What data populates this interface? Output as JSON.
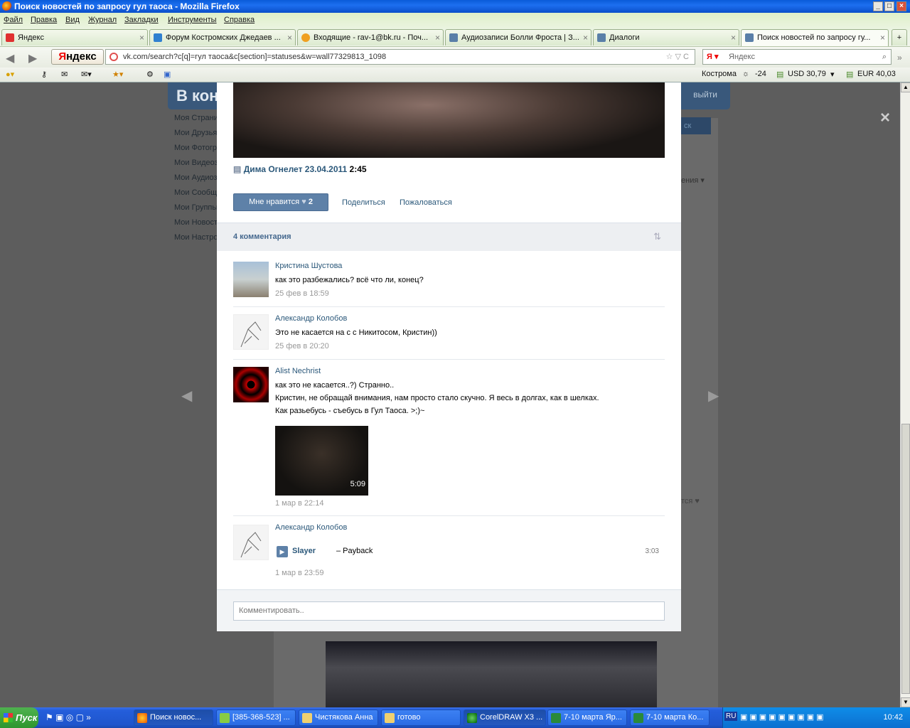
{
  "window": {
    "title": "Поиск новостей по запросу гул таоса - Mozilla Firefox"
  },
  "menu": [
    "Файл",
    "Правка",
    "Вид",
    "Журнал",
    "Закладки",
    "Инструменты",
    "Справка"
  ],
  "tabs": [
    {
      "label": "Яндекс",
      "color": "#e03030"
    },
    {
      "label": "Форум Костромских Джедаев ...",
      "color": "#3080d0"
    },
    {
      "label": "Входящие - rav-1@bk.ru - Поч...",
      "color": "#f0a020"
    },
    {
      "label": "Аудиозаписи Болли Фроста | З...",
      "color": "#5a7fa8"
    },
    {
      "label": "Диалоги",
      "color": "#5a7fa8"
    },
    {
      "label": "Поиск новостей по запросу гу...",
      "color": "#5a7fa8"
    }
  ],
  "nav": {
    "yandex_label_first": "Я",
    "yandex_label_rest": "ндекс",
    "url": "vk.com/search?c[q]=гул таоса&c[section]=statuses&w=wall77329813_1098",
    "search_placeholder": "Яндекс"
  },
  "toolbar2": {
    "city": "Кострома",
    "temp": "-24",
    "usd": "USD 30,79",
    "eur": "EUR 40,03"
  },
  "vk": {
    "logo": "В кон",
    "exit": "выйти",
    "sidebar": [
      "Моя Страни",
      "Мои Друзья",
      "Мои Фотогр",
      "Мои Видеоз",
      "Мои Аудиоз",
      "Мои Сообще",
      "Мои Группы",
      "Мои Новост",
      "Мои Настро"
    ],
    "bg_search": "ск",
    "bg_sort": "ения ▾",
    "bg_like": "тся ♥"
  },
  "post": {
    "video_author": "Дима Огнелет",
    "video_date": "23.04.2011",
    "video_duration": "2:45",
    "like_label": "Мне нравится",
    "like_count": "2",
    "share": "Поделиться",
    "report": "Пожаловаться",
    "comments_title": "4 комментария"
  },
  "comments": [
    {
      "author": "Кристина Шустова",
      "text": "как это разбежались? всё что ли, конец?",
      "date": "25 фев в 18:59"
    },
    {
      "author": "Александр Колобов",
      "text": "Это не касается на с с Никитосом, Кристин))",
      "date": "25 фев в 20:20"
    },
    {
      "author": "Alist Nechrist",
      "lines": [
        "как это не касается..?) Странно..",
        "Кристин, не обращай внимания, нам просто стало скучно. Я весь в долгах, как в шелках.",
        "Как разьебусь - съебусь в Гул Таоса. >;)~"
      ],
      "video_duration": "5:09",
      "date": "1 мар в 22:14"
    },
    {
      "author": "Александр Колобов",
      "audio_artist": "Slayer",
      "audio_title": "– Payback",
      "audio_duration": "3:03",
      "date": "1 мар в 23:59"
    }
  ],
  "comment_placeholder": "Комментировать..",
  "taskbar": {
    "start": "Пуск",
    "tasks": [
      "Поиск новос...",
      "[385-368-523] ...",
      "Чистякова Анна",
      "готово",
      "CorelDRAW X3 ...",
      "7-10 марта  Яр...",
      "7-10 марта  Ко..."
    ],
    "lang": "RU",
    "clock": "10:42"
  }
}
